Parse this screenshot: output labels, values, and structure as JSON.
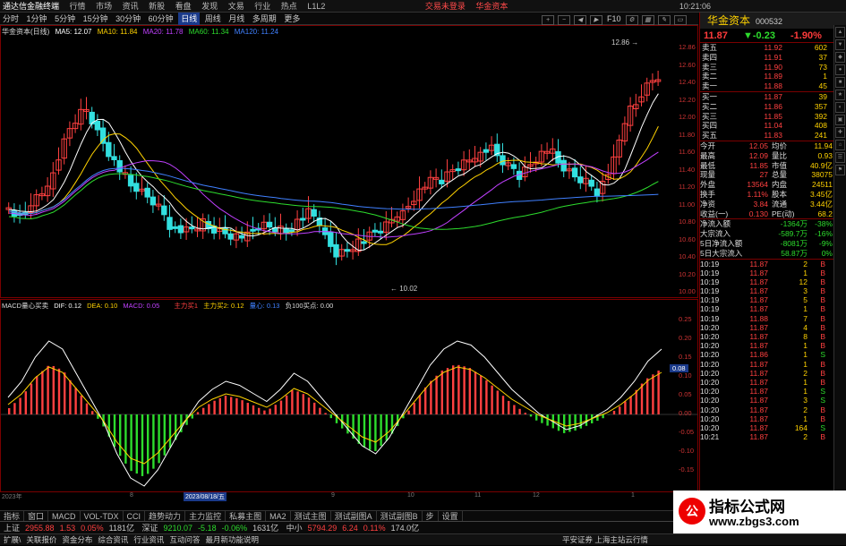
{
  "menubar": {
    "app_title": "通达信金融终端",
    "items": [
      "行情",
      "市场",
      "资讯",
      "新股",
      "看盘",
      "发现",
      "文易",
      "行业",
      "热点",
      "L1L2"
    ],
    "notice1": "交易未登录",
    "notice2": "华金资本",
    "time": "10:21:06"
  },
  "toolbar": {
    "periods": [
      "分时",
      "1分钟",
      "5分钟",
      "15分钟",
      "30分钟",
      "60分钟",
      "日线",
      "周线",
      "月线",
      "多周期",
      "更多"
    ],
    "selected": "日线",
    "right_label": "F10"
  },
  "chart": {
    "title": "华金资本(日线)",
    "ma": [
      "MA5: 12.07",
      "MA10: 11.84",
      "MA20: 11.78",
      "MA60: 11.34",
      "MA120: 11.24"
    ],
    "high_label": "12.86",
    "low_label": "10.02",
    "y_ticks": [
      "12.86",
      "12.60",
      "12.40",
      "12.20",
      "12.00",
      "11.80",
      "11.60",
      "11.40",
      "11.20",
      "11.00",
      "10.80",
      "10.60",
      "10.40",
      "10.20",
      "10.00"
    ]
  },
  "macd": {
    "title": "MACD量心买卖",
    "dif": "DIF: 0.12",
    "dea": "DEA: 0.10",
    "macd": "MACD: 0.05",
    "buy1": "主力买1",
    "buy2": "主力买2: 0.12",
    "heart": "量心: 0.13",
    "sell": "负100买点: 0.00",
    "y_ticks": [
      "0.25",
      "0.20",
      "0.15",
      "0.10",
      "0.05",
      "0.00",
      "-0.05",
      "-0.10",
      "-0.15"
    ],
    "cur": "0.08"
  },
  "x_axis": {
    "labels": [
      "2023年",
      "8",
      "2023/08/18/五",
      "9",
      "10",
      "11",
      "12",
      "1"
    ]
  },
  "tabs": [
    "指标",
    "窗口",
    "MACD",
    "VOL-TDX",
    "CCI",
    "趋势动力",
    "主力监控",
    "私募主图",
    "MA2",
    "测试主图",
    "测试副图A",
    "测试副图B",
    "步",
    "设置"
  ],
  "quote": {
    "name": "华金资本",
    "code": "000532",
    "price": "11.87",
    "change": "▼-0.23",
    "pct": "-1.90%",
    "asks": [
      [
        "卖五",
        "11.92",
        "602"
      ],
      [
        "卖四",
        "11.91",
        "37"
      ],
      [
        "卖三",
        "11.90",
        "73"
      ],
      [
        "卖二",
        "11.89",
        "1"
      ],
      [
        "卖一",
        "11.88",
        "45"
      ]
    ],
    "bids": [
      [
        "买一",
        "11.87",
        "39"
      ],
      [
        "买二",
        "11.86",
        "357"
      ],
      [
        "买三",
        "11.85",
        "392"
      ],
      [
        "买四",
        "11.04",
        "408"
      ],
      [
        "买五",
        "11.83",
        "241"
      ]
    ],
    "stats": [
      [
        "今开",
        "12.05",
        "均价",
        "11.94"
      ],
      [
        "最高",
        "12.09",
        "量比",
        "0.93"
      ],
      [
        "最低",
        "11.85",
        "市值",
        "40.9亿"
      ],
      [
        "现量",
        "27",
        "总量",
        "38075"
      ],
      [
        "外盘",
        "13564",
        "内盘",
        "24511"
      ],
      [
        "换手",
        "1.11%",
        "股本",
        "3.45亿"
      ],
      [
        "净资",
        "3.84",
        "流通",
        "3.44亿"
      ],
      [
        "收益(一)",
        "0.130",
        "PE(动)",
        "68.2"
      ]
    ],
    "flows": [
      [
        "净流入额",
        "-1364万",
        "-38%"
      ],
      [
        "大宗流入",
        "-589.7万",
        "-16%"
      ],
      [
        "5日净流入额",
        "-8081万",
        "-9%"
      ],
      [
        "5日大宗流入",
        "58.87万",
        "0%"
      ]
    ],
    "ticks": [
      [
        "10:19",
        "11.87",
        "2",
        "B"
      ],
      [
        "10:19",
        "11.87",
        "1",
        "B"
      ],
      [
        "10:19",
        "11.87",
        "12",
        "B"
      ],
      [
        "10:19",
        "11.87",
        "3",
        "B"
      ],
      [
        "10:19",
        "11.87",
        "5",
        "B"
      ],
      [
        "10:19",
        "11.87",
        "1",
        "B"
      ],
      [
        "10:19",
        "11.88",
        "7",
        "B"
      ],
      [
        "10:20",
        "11.87",
        "4",
        "B"
      ],
      [
        "10:20",
        "11.87",
        "8",
        "B"
      ],
      [
        "10:20",
        "11.87",
        "1",
        "B"
      ],
      [
        "10:20",
        "11.86",
        "1",
        "S"
      ],
      [
        "10:20",
        "11.87",
        "1",
        "B"
      ],
      [
        "10:20",
        "11.87",
        "2",
        "B"
      ],
      [
        "10:20",
        "11.87",
        "1",
        "B"
      ],
      [
        "10:20",
        "11.87",
        "1",
        "S"
      ],
      [
        "10:20",
        "11.87",
        "3",
        "S"
      ],
      [
        "10:20",
        "11.87",
        "2",
        "B"
      ],
      [
        "10:20",
        "11.87",
        "1",
        "B"
      ],
      [
        "10:20",
        "11.87",
        "164",
        "S"
      ],
      [
        "10:21",
        "11.87",
        "2",
        "B"
      ]
    ]
  },
  "status": {
    "idx1_name": "上证",
    "idx1_val": "2955.88",
    "idx1_chg": "1.53",
    "idx1_pct": "0.05%",
    "idx1_amt": "1181亿",
    "idx2_name": "深证",
    "idx2_val": "9210.07",
    "idx2_chg": "-5.18",
    "idx2_pct": "-0.06%",
    "idx2_amt": "1631亿",
    "idx3_name": "中小",
    "idx3_val": "5794.29",
    "idx3_chg": "6.24",
    "idx3_pct": "0.11%",
    "idx3_amt": "174.0亿",
    "broker": "平安证券 上海主站云行情"
  },
  "bottom": [
    "扩展\\",
    "关联报价",
    "资金分布",
    "综合资讯",
    "行业资讯",
    "互动问答",
    "最月新功能说明"
  ],
  "watermark": {
    "line1": "指标公式网",
    "line2": "www.zbgs3.com",
    "logo": "公"
  },
  "colors": {
    "up": "#ff4040",
    "down": "#32e0e0",
    "ma5": "#ffffff",
    "ma10": "#ffd200",
    "ma20": "#c040ff",
    "ma60": "#2ddc2d",
    "ma120": "#4080ff"
  }
}
